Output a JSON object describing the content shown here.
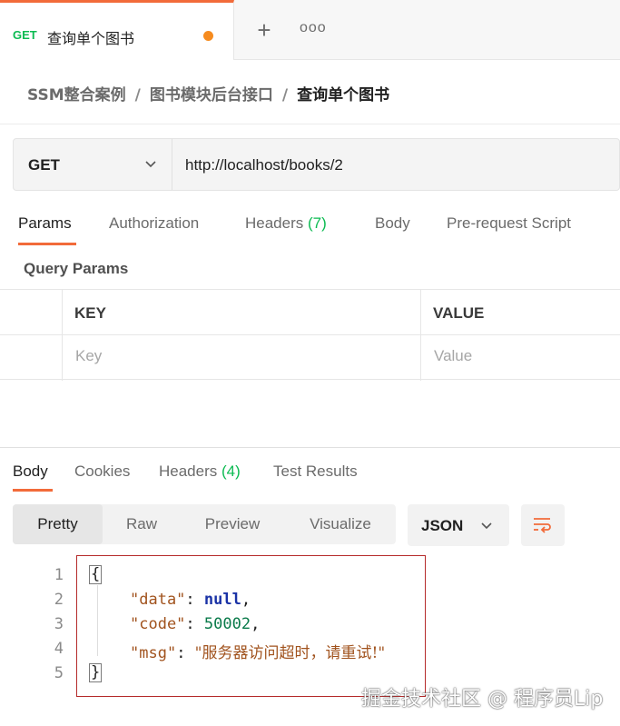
{
  "tab": {
    "method": "GET",
    "title": "查询单个图书",
    "new_tab": "+",
    "more": "ooo"
  },
  "breadcrumb": {
    "items": [
      "SSM整合案例",
      "图书模块后台接口"
    ],
    "separator": "/",
    "current": "查询单个图书"
  },
  "request": {
    "method": "GET",
    "url": "http://localhost/books/2"
  },
  "request_tabs": {
    "params": "Params",
    "authorization": "Authorization",
    "headers": "Headers",
    "headers_count": "(7)",
    "body": "Body",
    "prerequest": "Pre-request Script"
  },
  "query_params": {
    "title": "Query Params",
    "col_key": "KEY",
    "col_value": "VALUE",
    "key_placeholder": "Key",
    "value_placeholder": "Value"
  },
  "response_tabs": {
    "body": "Body",
    "cookies": "Cookies",
    "headers": "Headers",
    "headers_count": "(4)",
    "test_results": "Test Results"
  },
  "view_modes": {
    "pretty": "Pretty",
    "raw": "Raw",
    "preview": "Preview",
    "visualize": "Visualize"
  },
  "format": "JSON",
  "code": {
    "line_numbers": [
      "1",
      "2",
      "3",
      "4",
      "5"
    ],
    "open_brace": "{",
    "close_brace": "}",
    "data_key": "\"data\"",
    "data_value": "null",
    "code_key": "\"code\"",
    "code_value": "50002",
    "msg_key": "\"msg\"",
    "msg_value": "\"服务器访问超时，请重试!\"",
    "colon": ": ",
    "comma": ","
  },
  "watermark": "掘金技术社区 @ 程序员Lip"
}
